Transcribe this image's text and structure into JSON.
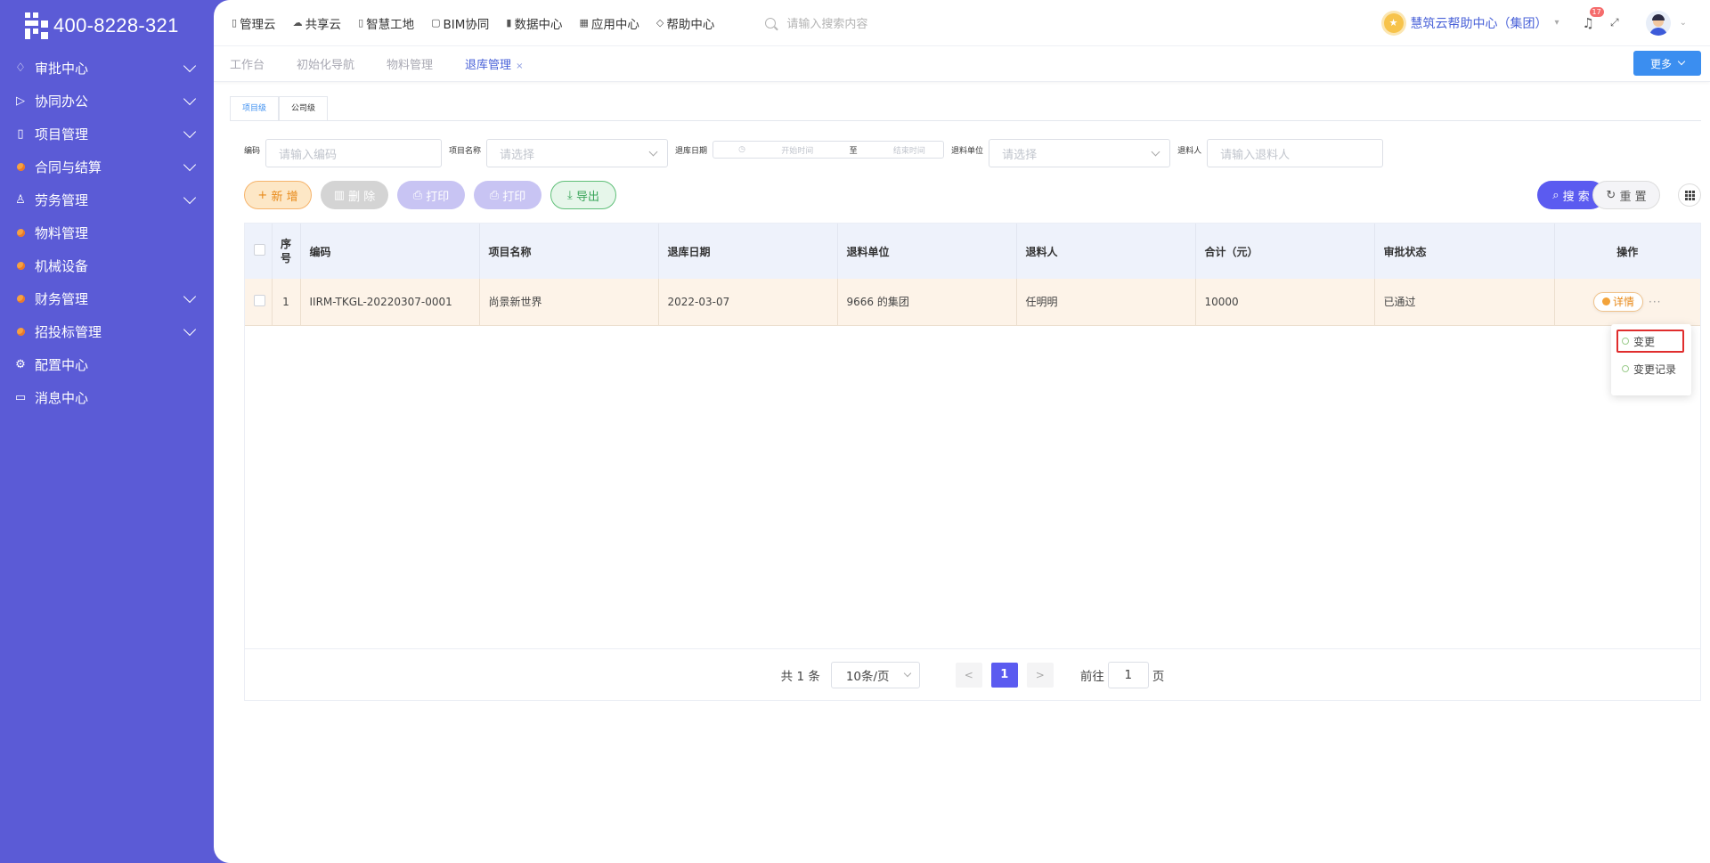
{
  "brand": {
    "phone": "400-8228-321"
  },
  "sidebar": {
    "items": [
      {
        "label": "审批中心",
        "icon": "bell-icon",
        "expandable": true
      },
      {
        "label": "协同办公",
        "icon": "send-icon",
        "expandable": true
      },
      {
        "label": "项目管理",
        "icon": "book-icon",
        "expandable": true
      },
      {
        "label": "合同与结算",
        "icon": "orange-dot-icon",
        "expandable": true
      },
      {
        "label": "劳务管理",
        "icon": "worker-icon",
        "expandable": true
      },
      {
        "label": "物料管理",
        "icon": "orange-dot-icon",
        "expandable": false
      },
      {
        "label": "机械设备",
        "icon": "orange-dot-icon",
        "expandable": false
      },
      {
        "label": "财务管理",
        "icon": "orange-dot-icon",
        "expandable": true
      },
      {
        "label": "招投标管理",
        "icon": "orange-dot-icon",
        "expandable": true
      },
      {
        "label": "配置中心",
        "icon": "gear-icon",
        "expandable": false
      },
      {
        "label": "消息中心",
        "icon": "message-icon",
        "expandable": false
      }
    ]
  },
  "topnav": {
    "items": [
      {
        "label": "管理云",
        "icon": "doc-icon"
      },
      {
        "label": "共享云",
        "icon": "cloud-icon"
      },
      {
        "label": "智慧工地",
        "icon": "book-icon"
      },
      {
        "label": "BIM协同",
        "icon": "bim-icon"
      },
      {
        "label": "数据中心",
        "icon": "bar-chart-icon"
      },
      {
        "label": "应用中心",
        "icon": "grid-icon"
      },
      {
        "label": "帮助中心",
        "icon": "diamond-icon"
      }
    ],
    "search_placeholder": "请输入搜索内容",
    "help_center": "慧筑云帮助中心（集团）",
    "notification_count": "17"
  },
  "page_tabs": {
    "items": [
      {
        "label": "工作台",
        "active": false
      },
      {
        "label": "初始化导航",
        "active": false
      },
      {
        "label": "物料管理",
        "active": false
      },
      {
        "label": "退库管理",
        "active": true
      }
    ],
    "more_label": "更多"
  },
  "level_tabs": [
    "项目级",
    "公司级"
  ],
  "filters": {
    "code_label": "编码",
    "code_placeholder": "请输入编码",
    "project_label": "项目名称",
    "project_placeholder": "请选择",
    "date_label": "退库日期",
    "date_start": "开始时间",
    "date_sep": "至",
    "date_end": "结束时间",
    "unit_label": "退料单位",
    "unit_placeholder": "请选择",
    "person_label": "退料人",
    "person_placeholder": "请输入退料人"
  },
  "actions": {
    "add": "新 增",
    "delete": "删 除",
    "print1": "打印",
    "print2": "打印",
    "export": "导出",
    "search": "搜 索",
    "reset": "重 置"
  },
  "table": {
    "headers": [
      "序号",
      "编码",
      "项目名称",
      "退库日期",
      "退料单位",
      "退料人",
      "合计（元）",
      "审批状态",
      "操作"
    ],
    "rows": [
      {
        "seq": "1",
        "code": "IIRM-TKGL-20220307-0001",
        "project": "尚景新世界",
        "date": "2022-03-07",
        "unit": "9666 的集团",
        "person": "任明明",
        "total": "10000",
        "status": "已通过",
        "detail": "详情"
      }
    ]
  },
  "popover": {
    "items": [
      "变更",
      "变更记录"
    ]
  },
  "pagination": {
    "total": "共 1 条",
    "page_size": "10条/页",
    "current": "1",
    "goto_prefix": "前往",
    "goto_value": "1",
    "goto_suffix": "页"
  },
  "colors": {
    "sidebar": "#5b5bd6",
    "primary": "#5b5bf0",
    "accent_blue": "#3b8ef0",
    "row_highlight": "#fdf3e8",
    "popover_highlight": "#e02d2d"
  }
}
